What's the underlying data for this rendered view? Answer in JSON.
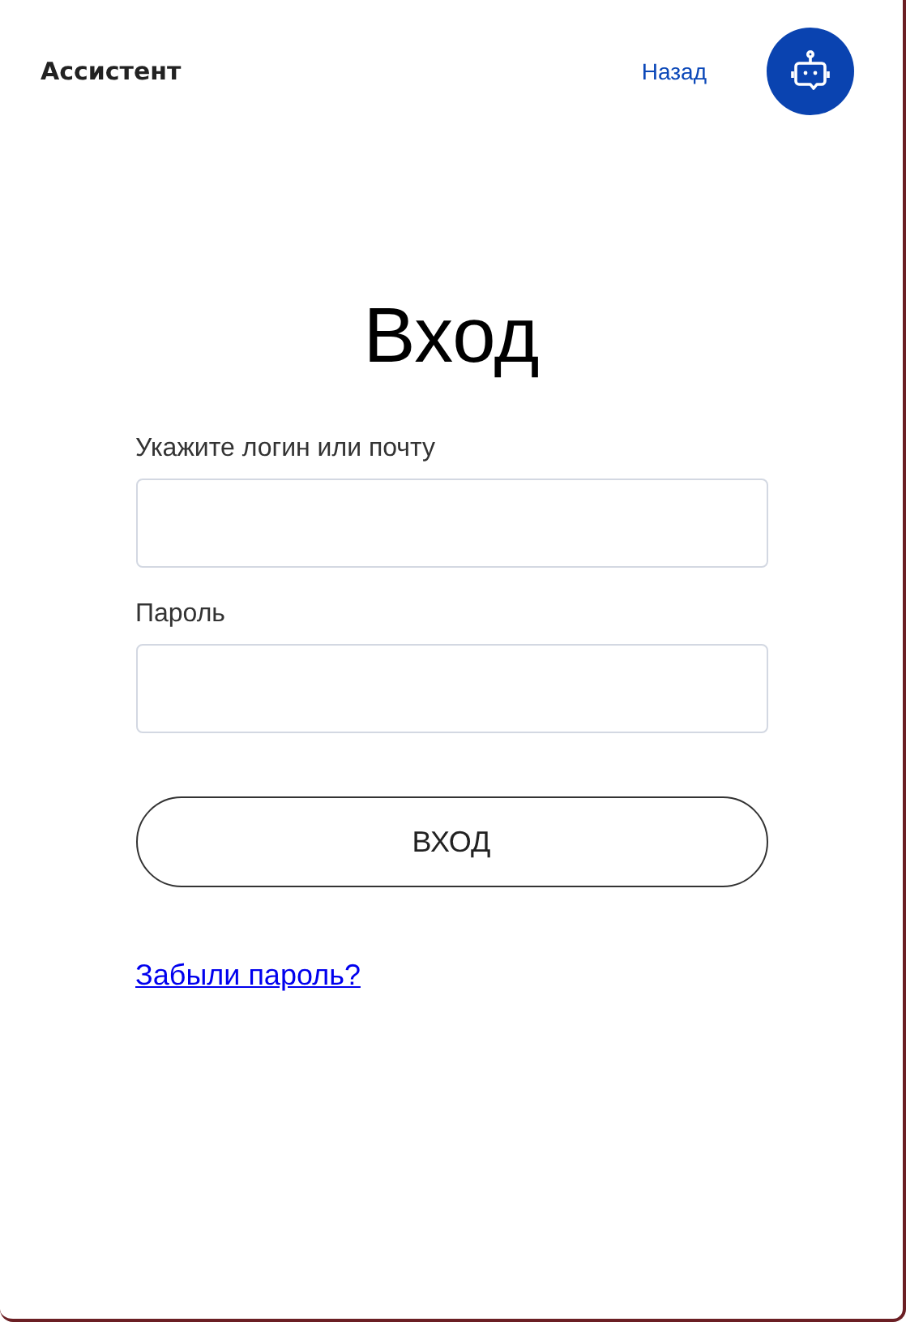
{
  "header": {
    "title": "Ассистент",
    "back_link": "Назад"
  },
  "form": {
    "heading": "Вход",
    "fields": [
      {
        "label": "Укажите логин или почту"
      },
      {
        "label": "Пароль"
      }
    ],
    "submit": "ВХОД",
    "forgot_link": "Забыли пароль?"
  }
}
